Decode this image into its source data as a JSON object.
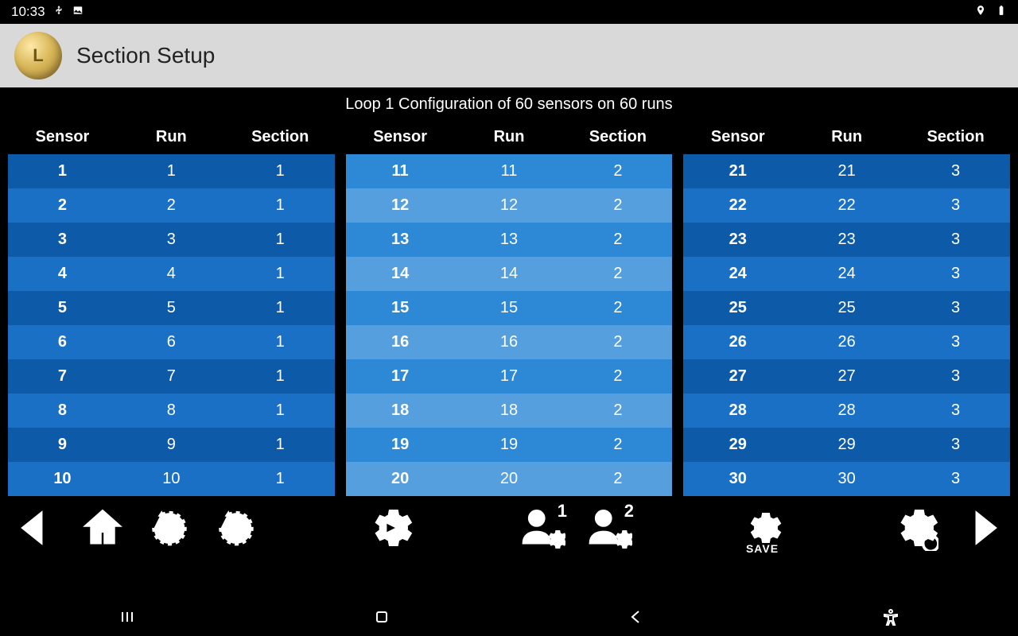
{
  "status": {
    "time": "10:33"
  },
  "header": {
    "title": "Section Setup",
    "logo_letter": "L"
  },
  "subtitle": "Loop 1  Configuration of 60 sensors on 60 runs",
  "columns": {
    "sensor": "Sensor",
    "run": "Run",
    "section": "Section"
  },
  "table1": [
    {
      "sensor": "1",
      "run": "1",
      "section": "1"
    },
    {
      "sensor": "2",
      "run": "2",
      "section": "1"
    },
    {
      "sensor": "3",
      "run": "3",
      "section": "1"
    },
    {
      "sensor": "4",
      "run": "4",
      "section": "1"
    },
    {
      "sensor": "5",
      "run": "5",
      "section": "1"
    },
    {
      "sensor": "6",
      "run": "6",
      "section": "1"
    },
    {
      "sensor": "7",
      "run": "7",
      "section": "1"
    },
    {
      "sensor": "8",
      "run": "8",
      "section": "1"
    },
    {
      "sensor": "9",
      "run": "9",
      "section": "1"
    },
    {
      "sensor": "10",
      "run": "10",
      "section": "1"
    }
  ],
  "table2": [
    {
      "sensor": "11",
      "run": "11",
      "section": "2"
    },
    {
      "sensor": "12",
      "run": "12",
      "section": "2"
    },
    {
      "sensor": "13",
      "run": "13",
      "section": "2"
    },
    {
      "sensor": "14",
      "run": "14",
      "section": "2"
    },
    {
      "sensor": "15",
      "run": "15",
      "section": "2"
    },
    {
      "sensor": "16",
      "run": "16",
      "section": "2"
    },
    {
      "sensor": "17",
      "run": "17",
      "section": "2"
    },
    {
      "sensor": "18",
      "run": "18",
      "section": "2"
    },
    {
      "sensor": "19",
      "run": "19",
      "section": "2"
    },
    {
      "sensor": "20",
      "run": "20",
      "section": "2"
    }
  ],
  "table3": [
    {
      "sensor": "21",
      "run": "21",
      "section": "3"
    },
    {
      "sensor": "22",
      "run": "22",
      "section": "3"
    },
    {
      "sensor": "23",
      "run": "23",
      "section": "3"
    },
    {
      "sensor": "24",
      "run": "24",
      "section": "3"
    },
    {
      "sensor": "25",
      "run": "25",
      "section": "3"
    },
    {
      "sensor": "26",
      "run": "26",
      "section": "3"
    },
    {
      "sensor": "27",
      "run": "27",
      "section": "3"
    },
    {
      "sensor": "28",
      "run": "28",
      "section": "3"
    },
    {
      "sensor": "29",
      "run": "29",
      "section": "3"
    },
    {
      "sensor": "30",
      "run": "30",
      "section": "3"
    }
  ],
  "toolbar": {
    "loop1_badge": "1",
    "loop2_badge": "2",
    "user1_badge": "1",
    "user2_badge": "2",
    "save_label": "SAVE"
  }
}
